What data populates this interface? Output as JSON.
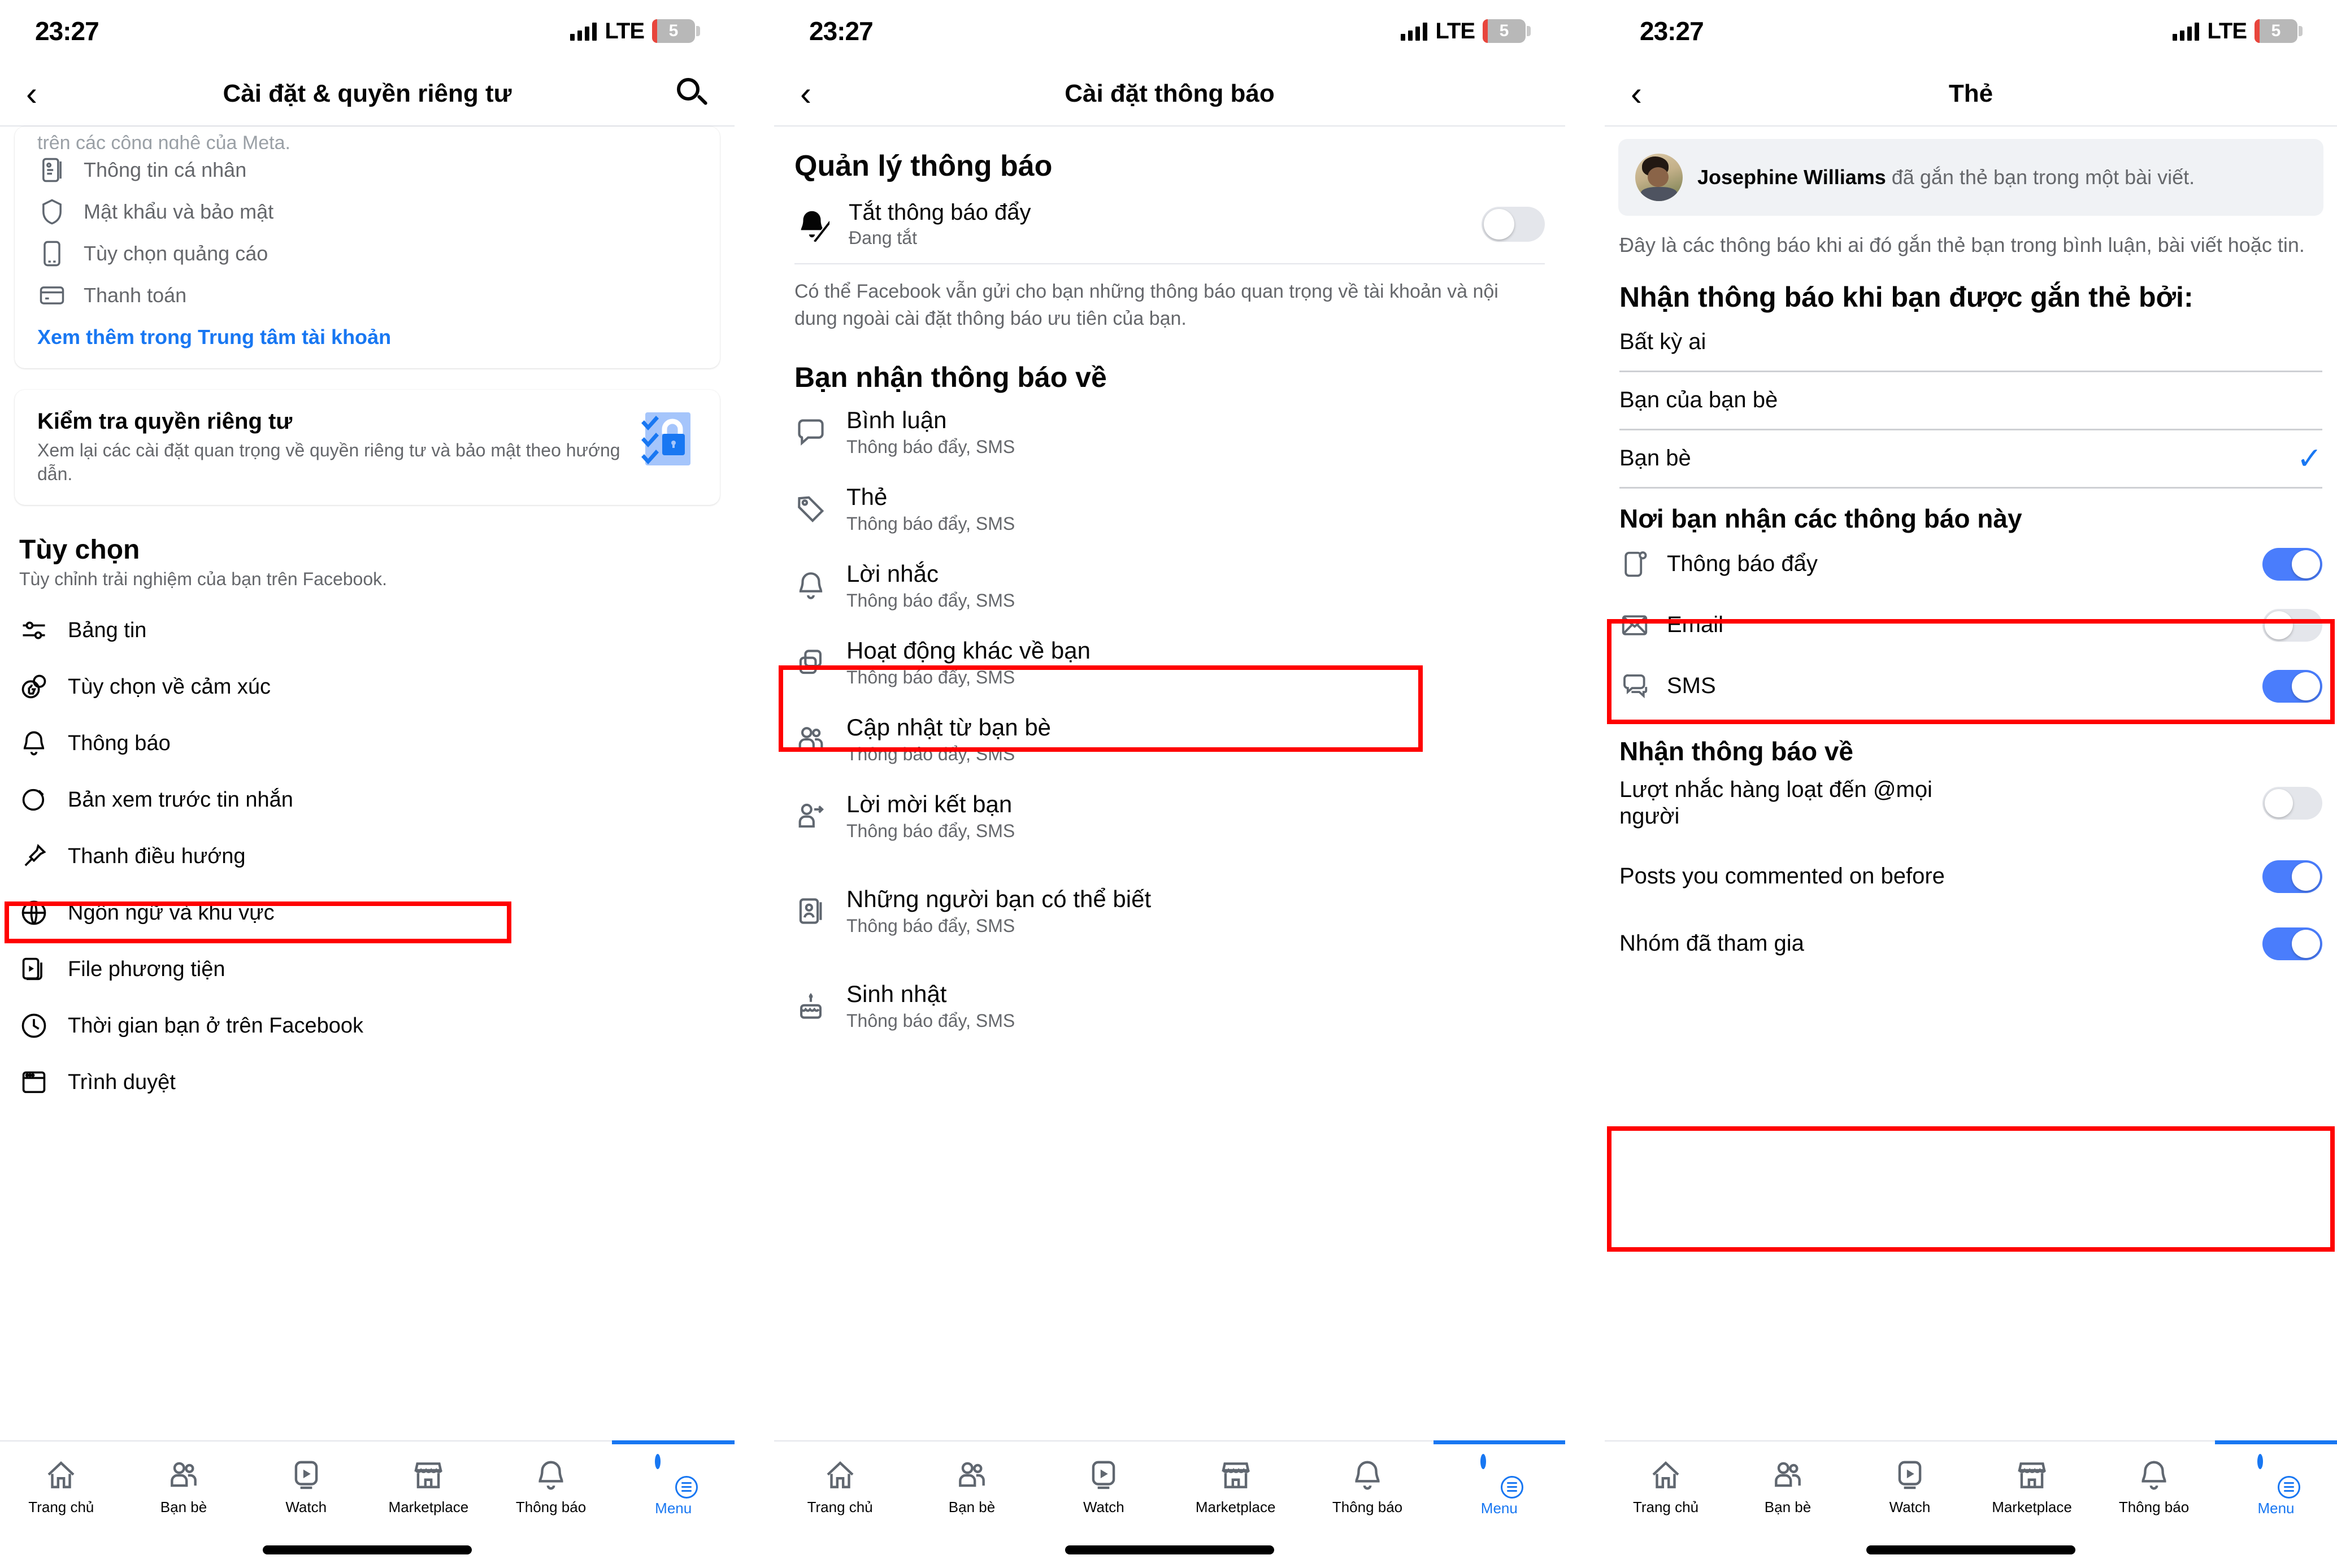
{
  "status_bar": {
    "time": "23:27",
    "network": "LTE",
    "battery": "5"
  },
  "screen1": {
    "nav": {
      "back": "‹",
      "title": "Cài đặt & quyền riêng tư",
      "search_icon": "search-icon"
    },
    "account_card": {
      "cut_text": "trên các công nghệ của Meta.",
      "items": [
        {
          "icon": "id-card-icon",
          "label": "Thông tin cá nhân"
        },
        {
          "icon": "shield-icon",
          "label": "Mật khẩu và bảo mật"
        },
        {
          "icon": "phone-ad-icon",
          "label": "Tùy chọn quảng cáo"
        },
        {
          "icon": "credit-card-icon",
          "label": "Thanh toán"
        }
      ],
      "link": "Xem thêm trong Trung tâm tài khoản"
    },
    "privacy_check": {
      "title": "Kiểm tra quyền riêng tư",
      "subtitle": "Xem lại các cài đặt quan trọng về quyền riêng tư và bảo mật theo hướng dẫn.",
      "art": "lock-checklist-icon"
    },
    "preferences": {
      "title": "Tùy chọn",
      "subtitle": "Tùy chỉnh trải nghiệm của bạn trên Facebook.",
      "items": [
        {
          "icon": "feed-sliders-icon",
          "label": "Bảng tin"
        },
        {
          "icon": "reactions-icon",
          "label": "Tùy chọn về cảm xúc"
        },
        {
          "icon": "bell-icon",
          "label": "Thông báo",
          "highlighted": true
        },
        {
          "icon": "message-preview-icon",
          "label": "Bản xem trước tin nhắn"
        },
        {
          "icon": "pin-icon",
          "label": "Thanh điều hướng"
        },
        {
          "icon": "globe-icon",
          "label": "Ngôn ngữ và khu vực"
        },
        {
          "icon": "media-files-icon",
          "label": "File phương tiện"
        },
        {
          "icon": "clock-icon",
          "label": "Thời gian bạn ở trên Facebook"
        },
        {
          "icon": "browser-icon",
          "label": "Trình duyệt"
        }
      ]
    }
  },
  "screen2": {
    "nav": {
      "back": "‹",
      "title": "Cài đặt thông báo"
    },
    "manage_title": "Quản lý thông báo",
    "push_off": {
      "icon": "bell-slash-icon",
      "title": "Tắt thông báo đẩy",
      "subtitle": "Đang tắt",
      "toggle_on": false
    },
    "description": "Có thể Facebook vẫn gửi cho bạn những thông báo quan trọng về tài khoản và nội dung ngoài cài đặt thông báo ưu tiên của bạn.",
    "section_title": "Bạn nhận thông báo về",
    "items": [
      {
        "icon": "comment-icon",
        "title": "Bình luận",
        "sub": "Thông báo đẩy, SMS",
        "highlighted": false
      },
      {
        "icon": "tag-icon",
        "title": "Thẻ",
        "sub": "Thông báo đẩy, SMS",
        "highlighted": true
      },
      {
        "icon": "bell-icon",
        "title": "Lời nhắc",
        "sub": "Thông báo đẩy, SMS",
        "highlighted": false
      },
      {
        "icon": "layers-icon",
        "title": "Hoạt động khác về bạn",
        "sub": "Thông báo đẩy, SMS",
        "highlighted": false
      },
      {
        "icon": "friends-icon",
        "title": "Cập nhật từ bạn bè",
        "sub": "Thông báo đẩy, SMS",
        "highlighted": false
      },
      {
        "icon": "friend-request-icon",
        "title": "Lời mời kết bạn",
        "sub": "Thông báo đẩy, SMS",
        "highlighted": false
      },
      {
        "icon": "contact-card-icon",
        "title": "Những người bạn có thể biết",
        "sub": "Thông báo đẩy, SMS",
        "highlighted": false
      },
      {
        "icon": "birthday-cake-icon",
        "title": "Sinh nhật",
        "sub": "Thông báo đẩy, SMS",
        "highlighted": false
      }
    ]
  },
  "screen3": {
    "nav": {
      "back": "‹",
      "title": "Thẻ"
    },
    "banner": {
      "name": "Josephine Williams",
      "rest": " đã gắn thẻ bạn trong một bài viết.",
      "avatar": "user-avatar"
    },
    "description": "Đây là các thông báo khi ai đó gắn thẻ bạn trong bình luận, bài viết hoặc tin.",
    "who_title": "Nhận thông báo khi bạn được gắn thẻ bởi:",
    "who_options": [
      {
        "label": "Bất kỳ ai",
        "selected": false,
        "highlighted": false
      },
      {
        "label": "Bạn của bạn bè",
        "selected": false,
        "highlighted": false
      },
      {
        "label": "Bạn bè",
        "selected": true,
        "highlighted": true
      }
    ],
    "check_mark": "✓",
    "where_title": "Nơi bạn nhận các thông báo này",
    "channels": [
      {
        "icon": "push-notification-icon",
        "label": "Thông báo đẩy",
        "on": true
      },
      {
        "icon": "envelope-icon",
        "label": "Email",
        "on": false
      },
      {
        "icon": "sms-icon",
        "label": "SMS",
        "on": true
      }
    ],
    "about_title": "Nhận thông báo về",
    "about_items": [
      {
        "label": "Lượt nhắc hàng loạt đến @mọi người",
        "on": false,
        "highlighted": true
      },
      {
        "label": "Posts you commented on before",
        "on": true,
        "highlighted": false
      },
      {
        "label": "Nhóm đã tham gia",
        "on": true,
        "highlighted": false
      }
    ]
  },
  "tabbar": {
    "items": [
      {
        "icon": "home-icon",
        "label": "Trang chủ",
        "active": false
      },
      {
        "icon": "friends-icon",
        "label": "Bạn bè",
        "active": false
      },
      {
        "icon": "watch-icon",
        "label": "Watch",
        "active": false
      },
      {
        "icon": "marketplace-icon",
        "label": "Marketplace",
        "active": false
      },
      {
        "icon": "bell-icon",
        "label": "Thông báo",
        "active": false
      },
      {
        "icon": "menu-avatar-icon",
        "label": "Menu",
        "active": true
      }
    ]
  },
  "colors": {
    "accent": "#1877f2",
    "toggle_on": "#4a7dfc",
    "highlight": "#ff0000",
    "text": "#050505",
    "secondary_text": "#65676b"
  }
}
